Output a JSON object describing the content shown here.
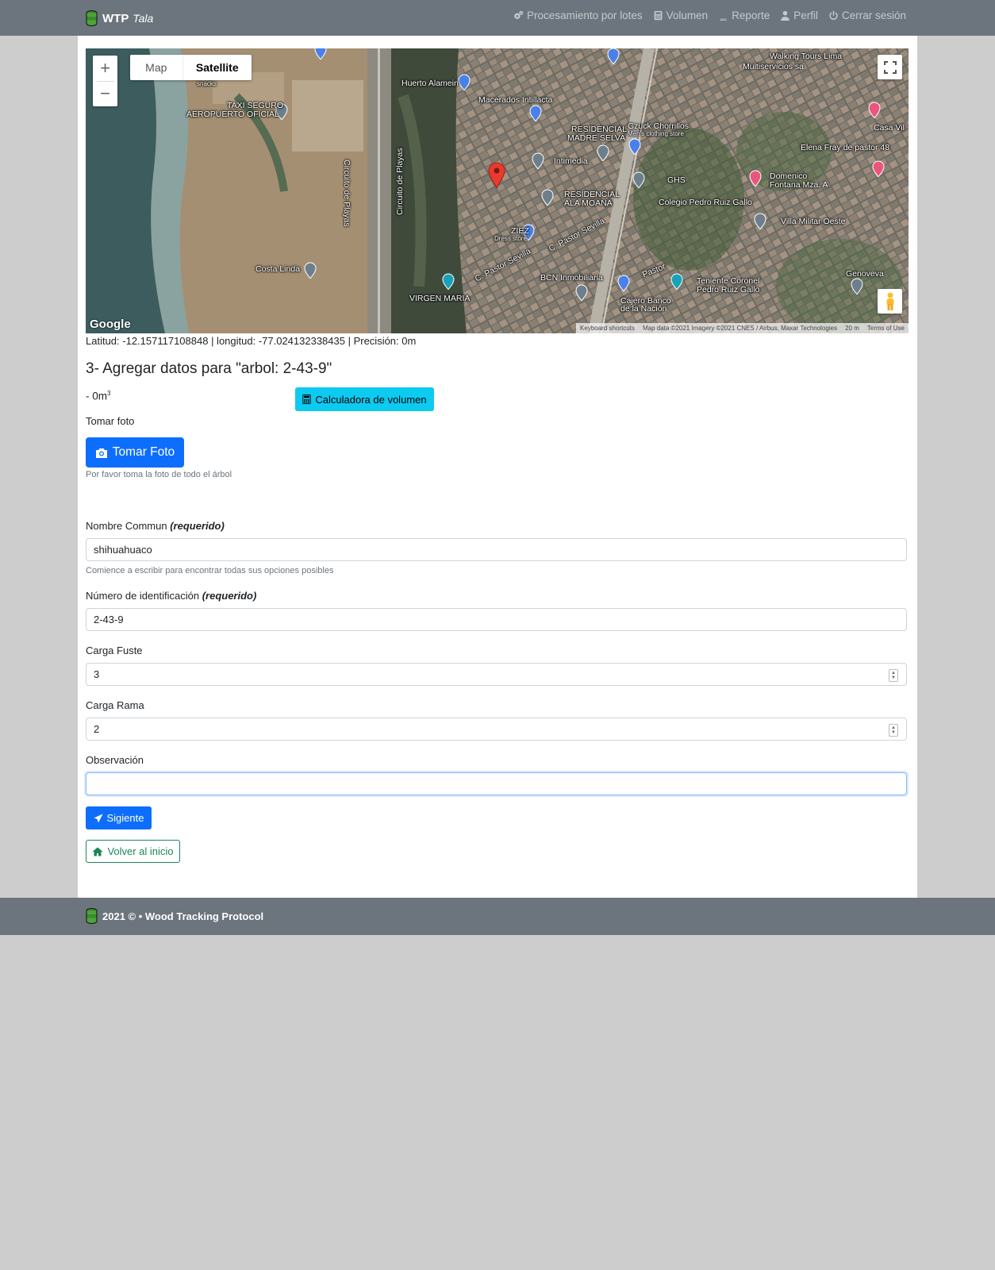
{
  "navbar": {
    "brand": "WTP",
    "brand_sub": "Tala",
    "links": [
      {
        "label": "Procesamiento por lotes",
        "icon": "gears-icon"
      },
      {
        "label": "Volumen",
        "icon": "calculator-icon"
      },
      {
        "label": "Reporte",
        "icon": "book-icon"
      },
      {
        "label": "Perfil",
        "icon": "user-icon"
      },
      {
        "label": "Cerrar sesión",
        "icon": "power-icon"
      }
    ]
  },
  "map": {
    "type_map": "Map",
    "type_satellite": "Satellite",
    "google": "Google",
    "attribution": [
      "Keyboard shortcuts",
      "Map data ©2021 Imagery ©2021 CNES / Airbus, Maxar Technologies",
      "20 m",
      "Terms of Use"
    ],
    "labels": [
      "Huerto Alamein",
      "Macerados Intillacta",
      "Walking Tours Lima",
      "Multiservicios sa",
      "TAXI SEGURO",
      "AEROPUERTO OFICIAL",
      "RESIDENCIAL",
      "MADRE SELVA",
      "Gzuck Chorrillos",
      "Men's clothing store",
      "Casa Vil",
      "Elena Fray de pastor 48",
      "Intimedia",
      "GHS",
      "Domenico",
      "Fontana Mza. A",
      "RESIDENCIAL",
      "ALA MOANA",
      "Colegio Pedro Ruiz Gallo",
      "Villa Militar Oeste",
      "ZIEZ",
      "Dress store",
      "C. Pastor Sevilla",
      "C. Pastor Sevilla",
      "Costa Linda",
      "BCN Inmobiliaria",
      "Teniente Coronel",
      "Pedro Ruiz Gallo",
      "Genoveva",
      "VIRGEN MARIA",
      "Cajero Banco",
      "de la Nación",
      "Circuito de Playas",
      "Circuito de Playas",
      "Pastor",
      "snacks"
    ]
  },
  "coords": "Latitud: -12.157117108848 | longitud: -77.024132338435 | Precisión: 0m",
  "heading": "3- Agregar datos para \"arbol: 2-43-9\"",
  "volume": {
    "value": "- 0m",
    "unit_sup": "3",
    "button": "Calculadora de volumen"
  },
  "photo": {
    "label": "Tomar foto",
    "button": "Tomar Foto",
    "help": "Por favor toma la foto de todo el árbol"
  },
  "fields": {
    "common_name": {
      "label": "Nombre Commun",
      "required": "(requerido)",
      "value": "shihuahuaco",
      "help": "Comience a escribir para encontrar todas sus opciones posibles"
    },
    "id_number": {
      "label": "Número de identificación",
      "required": "(requerido)",
      "value": "2-43-9"
    },
    "carga_fuste": {
      "label": "Carga Fuste",
      "value": "3"
    },
    "carga_rama": {
      "label": "Carga Rama",
      "value": "2"
    },
    "observacion": {
      "label": "Observación",
      "value": ""
    }
  },
  "buttons": {
    "next": "Sigiente",
    "home": "Volver al inicio"
  },
  "footer": {
    "text": "2021 © • Wood Tracking Protocol"
  }
}
